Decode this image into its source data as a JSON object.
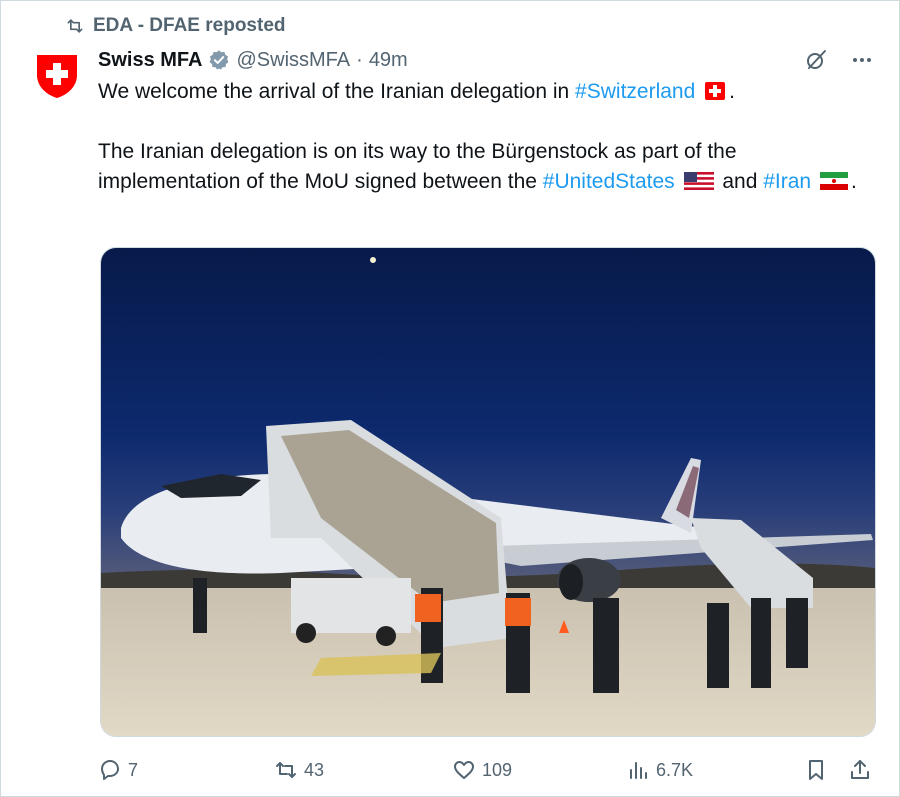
{
  "repost": {
    "label": "EDA - DFAE reposted",
    "icon": "repost-icon"
  },
  "author": {
    "name": "Swiss MFA",
    "handle": "@SwissMFA",
    "separator": "·",
    "time": "49m",
    "verified": true,
    "avatar_icon": "swiss-shield-logo"
  },
  "tweet": {
    "line1_pre": "We welcome the arrival of the Iranian delegation in ",
    "line1_tag": "#Switzerland",
    "line1_post": ".",
    "para2_pre": "The Iranian delegation is on its way to the Bürgenstock as part of the implementation of the MoU signed between the ",
    "para2_tag1": "#UnitedStates",
    "para2_mid": " and ",
    "para2_tag2": "#Iran",
    "para2_post": "."
  },
  "media": {
    "description_icon": "photo"
  },
  "stats": {
    "replies": "7",
    "reposts": "43",
    "likes": "109",
    "views": "6.7K"
  },
  "colors": {
    "accent": "#1d9bf0",
    "muted": "#536471",
    "text": "#0f1419",
    "swiss_red": "#ff0000"
  }
}
